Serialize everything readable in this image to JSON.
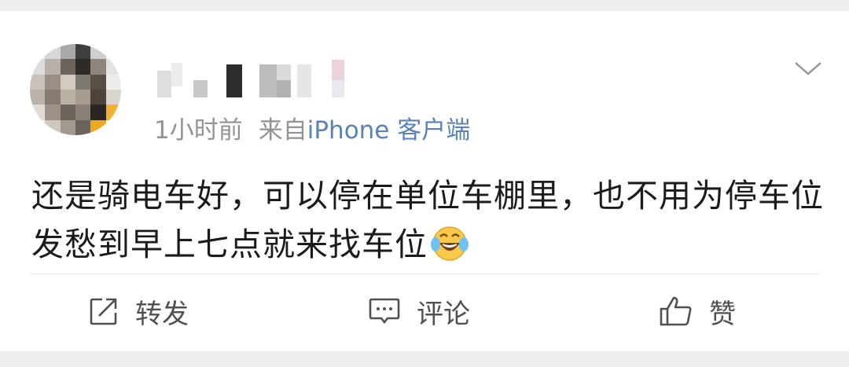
{
  "post": {
    "time": "1小时前",
    "source_prefix": "来自",
    "source_client": "iPhone 客户端",
    "text": "还是骑电车好，可以停在单位车棚里，也不用为停车位发愁到早上七点就来找车位",
    "emoji": "laugh-cry-emoji"
  },
  "actions": {
    "repost_label": "转发",
    "comment_label": "评论",
    "like_label": "赞"
  },
  "icons": {
    "menu": "chevron-down-icon",
    "repost": "repost-icon",
    "comment": "comment-icon",
    "like": "thumbs-up-icon"
  },
  "colors": {
    "link": "#5b82b8",
    "meta_text": "#939393",
    "body_text": "#1b1b1b",
    "action_text": "#505050"
  }
}
